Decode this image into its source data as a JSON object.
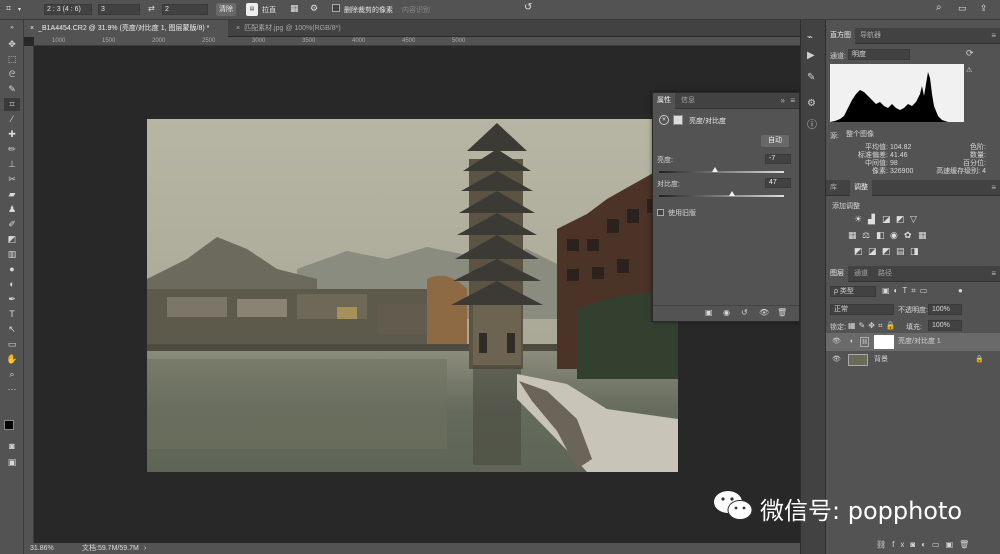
{
  "options_bar": {
    "crop_icon": "crop-icon",
    "ratio": "2 : 3 (4 : 6)",
    "width": "3",
    "height": "2",
    "clear": "清除",
    "straighten": "拉直",
    "delete_cropped": "删除裁剪的像素",
    "content_aware": "内容识别"
  },
  "doc_tabs": [
    {
      "label": "_B1A4454.CR2 @ 31.9% (亮度/对比度 1, 图层蒙版/8) *"
    },
    {
      "label": "匹配素材.jpg @ 100%(RGB/8*)"
    }
  ],
  "ruler_top": [
    "1000",
    "1500",
    "2000",
    "2500",
    "3000",
    "3500",
    "4000",
    "4500",
    "5000"
  ],
  "status": {
    "zoom": "31.86%",
    "doc": "文档:59.7M/59.7M"
  },
  "properties_panel": {
    "tabs": [
      "属性",
      "信息"
    ],
    "title": "亮度/对比度",
    "auto": "自动",
    "brightness_label": "亮度:",
    "brightness": "-7",
    "brightness_level": 0.45,
    "contrast_label": "对比度:",
    "contrast": "47",
    "contrast_level": 0.58,
    "legacy": "使用旧版"
  },
  "histogram_panel": {
    "tabs": [
      "直方图",
      "导航器"
    ],
    "channel_label": "通道:",
    "channel": "明度",
    "source_label": "源:",
    "source": "整个图像",
    "stats_left": [
      {
        "k": "平均值:",
        "v": "104.82"
      },
      {
        "k": "标准偏差:",
        "v": "41.46"
      },
      {
        "k": "中间值:",
        "v": "98"
      },
      {
        "k": "像素:",
        "v": "326900"
      }
    ],
    "stats_right": [
      {
        "k": "色阶:",
        "v": ""
      },
      {
        "k": "数量:",
        "v": ""
      },
      {
        "k": "百分位:",
        "v": ""
      },
      {
        "k": "高速缓存级别:",
        "v": "4"
      }
    ]
  },
  "adjust_panel": {
    "tabs": [
      "库",
      "调整"
    ],
    "add_label": "添加调整"
  },
  "layers_panel": {
    "tabs": [
      "图层",
      "通道",
      "路径"
    ],
    "filter": "ρ 类型",
    "blend": "正常",
    "opacity_label": "不透明度:",
    "opacity": "100%",
    "lock_label": "锁定:",
    "fill_label": "填充:",
    "fill": "100%",
    "layers": [
      {
        "name": "亮度/对比度 1"
      },
      {
        "name": "背景"
      }
    ]
  },
  "watermark": {
    "text": "微信号: popphoto"
  }
}
